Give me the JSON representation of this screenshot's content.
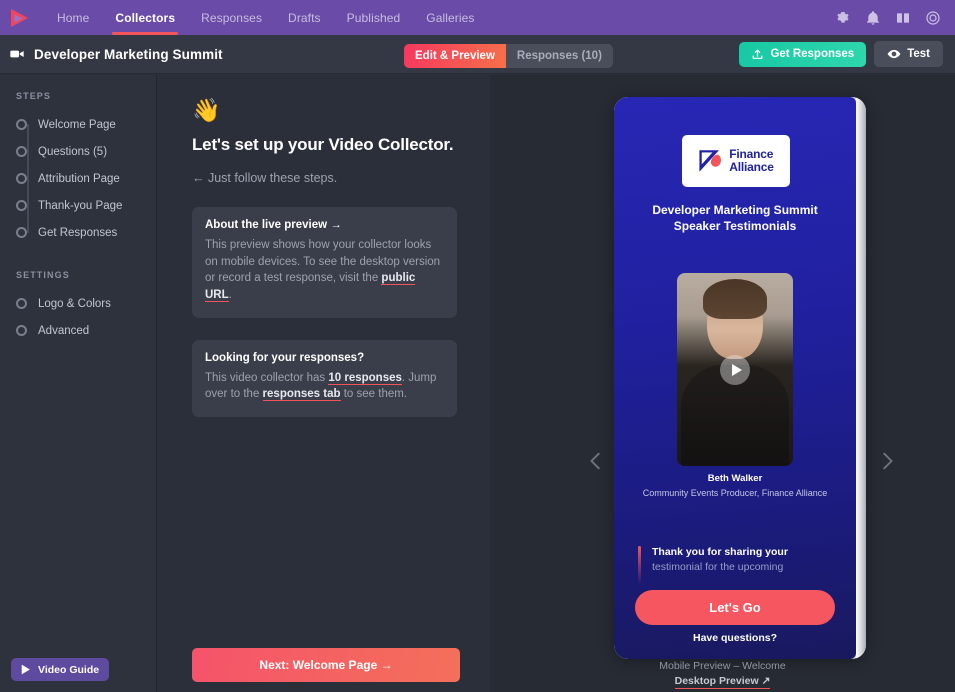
{
  "topnav": {
    "logo": "play-logo",
    "links": [
      {
        "label": "Home",
        "active": false
      },
      {
        "label": "Collectors",
        "active": true
      },
      {
        "label": "Responses",
        "active": false
      },
      {
        "label": "Drafts",
        "active": false
      },
      {
        "label": "Published",
        "active": false
      },
      {
        "label": "Galleries",
        "active": false
      }
    ],
    "icons": [
      "gear-icon",
      "bell-icon",
      "book-icon",
      "account-icon"
    ],
    "background": "#6a4ca8",
    "active_underline": "#f2545b"
  },
  "subheader": {
    "icon": "video-camera-icon",
    "title": "Developer Marketing Summit",
    "tabs": [
      {
        "label": "Edit & Preview",
        "active": true
      },
      {
        "label": "Responses (10)",
        "active": false
      }
    ],
    "get_responses_label": "Get Responses",
    "test_label": "Test",
    "accent_teal": "#1fcfa8",
    "accent_pink": "#f5385f"
  },
  "sidebar": {
    "steps_heading": "STEPS",
    "steps": [
      {
        "label": "Welcome Page"
      },
      {
        "label": "Questions (5)"
      },
      {
        "label": "Attribution Page"
      },
      {
        "label": "Thank-you Page"
      },
      {
        "label": "Get Responses"
      }
    ],
    "settings_heading": "SETTINGS",
    "settings": [
      {
        "label": "Logo & Colors"
      },
      {
        "label": "Advanced"
      }
    ],
    "video_guide_label": "Video Guide"
  },
  "main": {
    "wave_emoji": "👋",
    "heading": "Let's set up your Video Collector.",
    "subheading": "← Just follow these steps.",
    "card1": {
      "title": "About the live preview →",
      "text_before": "This preview shows how your collector looks on mobile devices. To see the desktop version or record a test response, visit the ",
      "link": "public URL",
      "text_after": "."
    },
    "card2": {
      "title": "Looking for your responses?",
      "text_before": "This video collector has ",
      "link1": "10 responses",
      "text_mid": ". Jump over to the ",
      "link2": "responses tab",
      "text_after": " to see them."
    },
    "next_button": "Next: Welcome Page →"
  },
  "preview": {
    "prev_arrow": "chevron-left-icon",
    "next_arrow": "chevron-right-icon",
    "brand_line1": "Finance",
    "brand_line2": "Alliance",
    "collector_title": "Developer Marketing Summit Speaker Testimonials",
    "play_icon": "play-icon",
    "speaker_name": "Beth Walker",
    "speaker_role": "Community Events Producer, Finance Alliance",
    "quote_line1": "Thank you for sharing your",
    "quote_line2": "testimonial for the upcoming",
    "cta_label": "Let's Go",
    "secondary_label": "Have questions?",
    "caption": "Mobile Preview – Welcome",
    "desktop_link": "Desktop Preview ↗",
    "screen_bg": "#20209f",
    "cta_color": "#f6565f"
  }
}
